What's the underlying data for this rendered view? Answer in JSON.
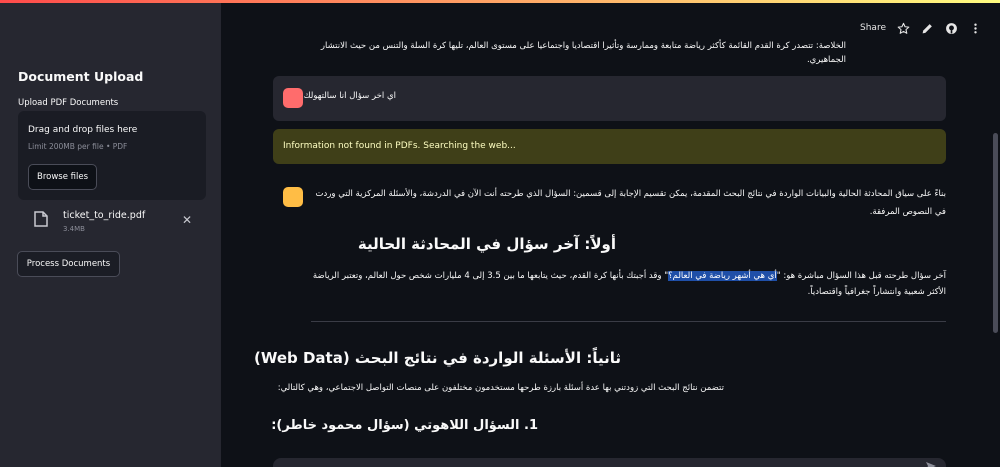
{
  "sidebar": {
    "title": "Document Upload",
    "upload_label": "Upload PDF Documents",
    "dropzone_title": "Drag and drop files here",
    "dropzone_limit": "Limit 200MB per file • PDF",
    "browse_label": "Browse files",
    "file": {
      "name": "ticket_to_ride.pdf",
      "size": "3.4MB"
    },
    "process_label": "Process Documents"
  },
  "toolbar": {
    "share_label": "Share"
  },
  "chat": {
    "summary": "الخلاصة: تتصدر كرة القدم القائمة كأكثر رياضة متابعة وممارسة وتأثيرا اقتصاديا واجتماعيا على مستوى العالم، تليها كرة السلة والتنس من حيث الانتشار الجماهيري.",
    "user_message": "اي اخر سؤال انا سالتهولك",
    "alert": "Information not found in PDFs. Searching the web...",
    "bot_intro": "بناءً على سياق المحادثة الحالية والبيانات الواردة في نتائج البحث المقدمة، يمكن تقسيم الإجابة إلى قسمين: السؤال الذي طرحته أنت الآن في الدردشة، والأسئلة المركزية التي وردت في النصوص المرفقة.",
    "heading1": "أولاً: آخر سؤال في المحادثة الحالية",
    "para1_before": "آخر سؤال طرحته قبل هذا السؤال مباشرة هو: \"",
    "para1_highlight": "أي هي أشهر رياضة في العالم؟",
    "para1_after": "\" وقد أجبتك بأنها كرة القدم، حيث يتابعها ما بين 3.5 إلى 4 مليارات شخص حول العالم، وتعتبر الرياضة الأكثر شعبية وانتشاراً جغرافياً واقتصادياً.",
    "heading2": "ثانياً: الأسئلة الواردة في نتائج البحث (Web Data)",
    "para2": "تتضمن نتائج البحث التي زودتني بها عدة أسئلة بارزة طرحها مستخدمون مختلفون على منصات التواصل الاجتماعي، وهي كالتالي:",
    "heading3": "1. السؤال اللاهوتي (سؤال محمود خاطر):"
  },
  "colors": {
    "background": "#0e1117",
    "sidebar": "#262730",
    "alert_bg": "#3f3f18",
    "user_avatar": "#ff6c6c",
    "bot_avatar": "#ffbd45",
    "highlight": "#1f4fa8"
  },
  "icons": {
    "star": "star-icon",
    "edit": "pencil-icon",
    "github": "github-icon",
    "menu": "more-vertical-icon",
    "file": "file-icon",
    "close": "close-icon",
    "send": "send-icon"
  }
}
